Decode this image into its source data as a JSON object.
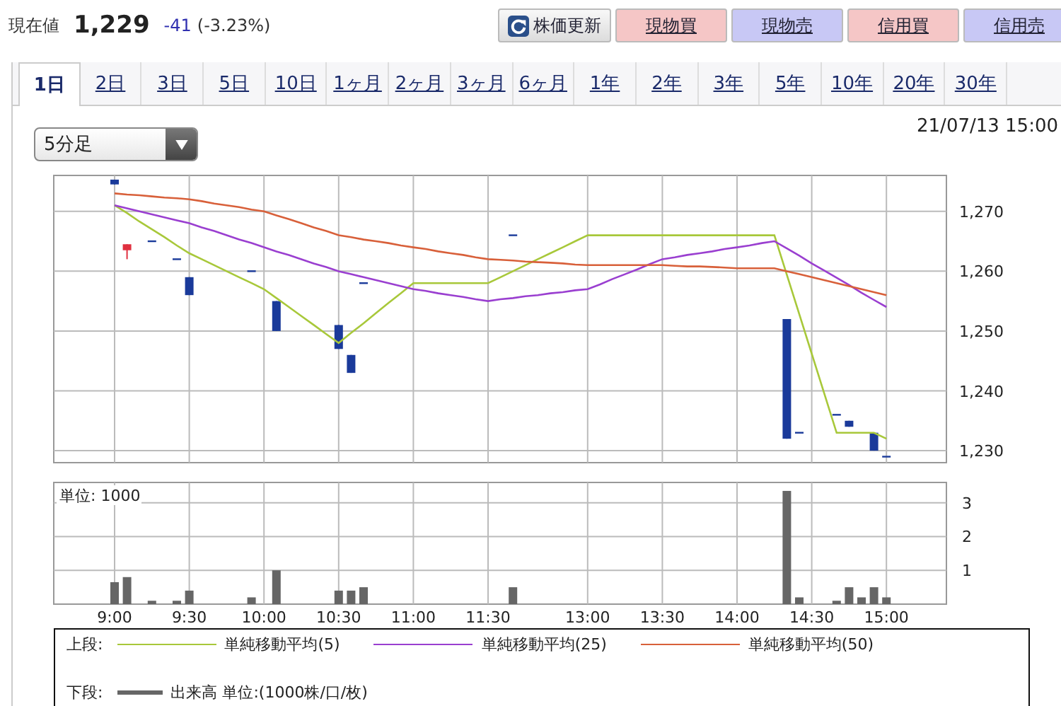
{
  "quote": {
    "label": "現在値",
    "price": "1,229",
    "change": "-41",
    "change_percent": "(-3.23%)"
  },
  "buttons": [
    {
      "kind": "refresh",
      "label": "株価更新"
    },
    {
      "kind": "buy",
      "label": "現物買"
    },
    {
      "kind": "sell",
      "label": "現物売"
    },
    {
      "kind": "buy",
      "label": "信用買"
    },
    {
      "kind": "sell",
      "label": "信用売"
    }
  ],
  "tabs": [
    {
      "label": "1日",
      "selected": true
    },
    {
      "label": "2日",
      "selected": false
    },
    {
      "label": "3日",
      "selected": false
    },
    {
      "label": "5日",
      "selected": false
    },
    {
      "label": "10日",
      "selected": false
    },
    {
      "label": "1ヶ月",
      "selected": false
    },
    {
      "label": "2ヶ月",
      "selected": false
    },
    {
      "label": "3ヶ月",
      "selected": false
    },
    {
      "label": "6ヶ月",
      "selected": false
    },
    {
      "label": "1年",
      "selected": false
    },
    {
      "label": "2年",
      "selected": false
    },
    {
      "label": "3年",
      "selected": false
    },
    {
      "label": "5年",
      "selected": false
    },
    {
      "label": "10年",
      "selected": false
    },
    {
      "label": "20年",
      "selected": false
    },
    {
      "label": "30年",
      "selected": false
    }
  ],
  "interval_select": {
    "value": "5分足"
  },
  "timestamp": "21/07/13 15:00",
  "price_chart": {
    "chart_data": {
      "type": "line",
      "grid": true,
      "ylim": [
        1228,
        1276
      ],
      "yticks": [
        {
          "value": 1230,
          "label": "1,230"
        },
        {
          "value": 1240,
          "label": "1,240"
        },
        {
          "value": 1250,
          "label": "1,250"
        },
        {
          "value": 1260,
          "label": "1,260"
        },
        {
          "value": 1270,
          "label": "1,270"
        }
      ],
      "series": [
        {
          "type": "candlestick",
          "color": "#1a3a9a",
          "ohlc": [
            [
              1275.3,
              1275.3,
              1274.5,
              1274.5
            ],
            null,
            null,
            [
              1265,
              1265,
              1265,
              1265
            ],
            null,
            [
              1262,
              1262,
              1262,
              1262
            ],
            [
              1259,
              1259,
              1256,
              1256
            ],
            null,
            null,
            null,
            null,
            [
              1260,
              1260,
              1260,
              1260
            ],
            null,
            [
              1255,
              1255,
              1250,
              1250
            ],
            null,
            null,
            null,
            null,
            [
              1251,
              1251,
              1247,
              1247
            ],
            [
              1246,
              1246,
              1243,
              1243
            ],
            [
              1258,
              1258,
              1258,
              1258
            ],
            null,
            null,
            null,
            null,
            null,
            null,
            null,
            null,
            null,
            null,
            null,
            [
              1266,
              1266,
              1266,
              1266
            ],
            null,
            null,
            null,
            null,
            null,
            null,
            null,
            null,
            null,
            null,
            null,
            null,
            null,
            null,
            null,
            null,
            null,
            null,
            null,
            null,
            null,
            [
              1252,
              1252,
              1232,
              1232
            ],
            [
              1233,
              1233,
              1233,
              1233
            ],
            null,
            null,
            [
              1236,
              1236,
              1236,
              1236
            ],
            [
              1235,
              1235,
              1234,
              1234
            ],
            null,
            [
              1233,
              1233,
              1230,
              1230
            ],
            [
              1229,
              1229,
              1229,
              1229
            ]
          ]
        },
        {
          "type": "candlestick",
          "color": "#e03040",
          "ohlc": [
            null,
            [
              1263.5,
              1264.5,
              1262,
              1264.5
            ],
            null,
            null,
            null,
            null,
            null,
            null,
            null,
            null,
            null,
            null,
            null,
            null,
            null,
            null,
            null,
            null,
            null,
            null,
            null,
            null,
            null,
            null,
            null,
            null,
            null,
            null,
            null,
            null,
            null,
            null,
            null,
            null,
            null,
            null,
            null,
            null,
            null,
            null,
            null,
            null,
            null,
            null,
            null,
            null,
            null,
            null,
            null,
            null,
            null,
            null,
            null,
            null,
            null,
            null,
            null,
            null,
            null,
            null,
            null,
            null,
            null
          ]
        },
        {
          "type": "line",
          "name": "単純移動平均(5)",
          "color": "#a8c83a",
          "values": [
            1271,
            1269.7,
            1268.3,
            1267,
            1265.7,
            1264.3,
            1263,
            1262,
            1261,
            1260,
            1259,
            1258,
            1257,
            1255.5,
            1254,
            1252.5,
            1251,
            1249.5,
            1248,
            1249.7,
            1251.3,
            1253,
            1254.7,
            1256.3,
            1258,
            1258,
            1258,
            1258,
            1258,
            1258,
            1258,
            1259,
            1260,
            1261,
            1262,
            1263,
            1264,
            1265,
            1266,
            1266,
            1266,
            1266,
            1266,
            1266,
            1266,
            1266,
            1266,
            1266,
            1266,
            1266,
            1266,
            1266,
            1266,
            1266,
            1259.4,
            1252.8,
            1246.2,
            1239.6,
            1233,
            1233,
            1233,
            1233,
            1232
          ]
        },
        {
          "type": "line",
          "name": "単純移動平均(25)",
          "color": "#9a3fd0",
          "values": [
            1271,
            1270.5,
            1270,
            1269.5,
            1269,
            1268.5,
            1268,
            1267.3,
            1266.7,
            1266,
            1265.3,
            1264.7,
            1264,
            1263.3,
            1262.7,
            1262,
            1261.3,
            1260.7,
            1260,
            1259.5,
            1259,
            1258.5,
            1258,
            1257.5,
            1257,
            1256.7,
            1256.3,
            1256,
            1255.7,
            1255.3,
            1255,
            1255.3,
            1255.5,
            1255.8,
            1256,
            1256.3,
            1256.5,
            1256.8,
            1257,
            1257.8,
            1258.7,
            1259.5,
            1260.3,
            1261.2,
            1262,
            1262.3,
            1262.7,
            1263,
            1263.3,
            1263.7,
            1264,
            1264.3,
            1264.7,
            1265,
            1263.8,
            1262.6,
            1261.3,
            1260.1,
            1258.9,
            1257.7,
            1256.4,
            1255.2,
            1254
          ]
        },
        {
          "type": "line",
          "name": "単純移動平均(50)",
          "color": "#d8603a",
          "values": [
            1273,
            1272.8,
            1272.7,
            1272.5,
            1272.3,
            1272.2,
            1272,
            1271.7,
            1271.3,
            1271,
            1270.7,
            1270.3,
            1270,
            1269.3,
            1268.7,
            1268,
            1267.3,
            1266.7,
            1266,
            1265.7,
            1265.3,
            1265,
            1264.7,
            1264.3,
            1264,
            1263.7,
            1263.3,
            1263,
            1262.7,
            1262.3,
            1262,
            1261.9,
            1261.8,
            1261.6,
            1261.5,
            1261.4,
            1261.3,
            1261.1,
            1261,
            1261,
            1261,
            1261,
            1261,
            1261,
            1261,
            1260.9,
            1260.8,
            1260.8,
            1260.7,
            1260.6,
            1260.5,
            1260.5,
            1260.5,
            1260.5,
            1260,
            1259.5,
            1259,
            1258.5,
            1258,
            1257.5,
            1257,
            1256.5,
            1256
          ]
        }
      ]
    }
  },
  "volume_chart": {
    "chart_data": {
      "type": "bar",
      "grid": true,
      "title": "単位: 1000",
      "categories": [
        "9:00",
        null,
        null,
        null,
        null,
        null,
        "9:30",
        null,
        null,
        null,
        null,
        null,
        "10:00",
        null,
        null,
        null,
        null,
        null,
        "10:30",
        null,
        null,
        null,
        null,
        null,
        "11:00",
        null,
        null,
        null,
        null,
        null,
        "11:30",
        null,
        null,
        null,
        null,
        null,
        null,
        null,
        "13:00",
        null,
        null,
        null,
        null,
        null,
        "13:30",
        null,
        null,
        null,
        null,
        null,
        "14:00",
        null,
        null,
        null,
        null,
        null,
        "14:30",
        null,
        null,
        null,
        null,
        null,
        "15:00"
      ],
      "ylim": [
        0,
        3.6
      ],
      "yticks": [
        1,
        2,
        3
      ],
      "series": [
        {
          "name": "出来高 単位:(1000株/口/枚)",
          "color": "#666666",
          "values": [
            0.65,
            0.8,
            null,
            0.1,
            null,
            0.1,
            0.4,
            null,
            null,
            null,
            null,
            0.2,
            null,
            1.0,
            null,
            null,
            null,
            null,
            0.4,
            0.4,
            0.5,
            null,
            null,
            null,
            null,
            null,
            null,
            null,
            null,
            null,
            null,
            null,
            0.5,
            null,
            null,
            null,
            null,
            null,
            null,
            null,
            null,
            null,
            null,
            null,
            null,
            null,
            null,
            null,
            null,
            null,
            null,
            null,
            null,
            null,
            3.35,
            0.2,
            null,
            null,
            0.1,
            0.5,
            0.2,
            0.5,
            0.2
          ]
        }
      ]
    }
  },
  "legend": {
    "upper_label": "上段:",
    "lower_label": "下段:"
  }
}
